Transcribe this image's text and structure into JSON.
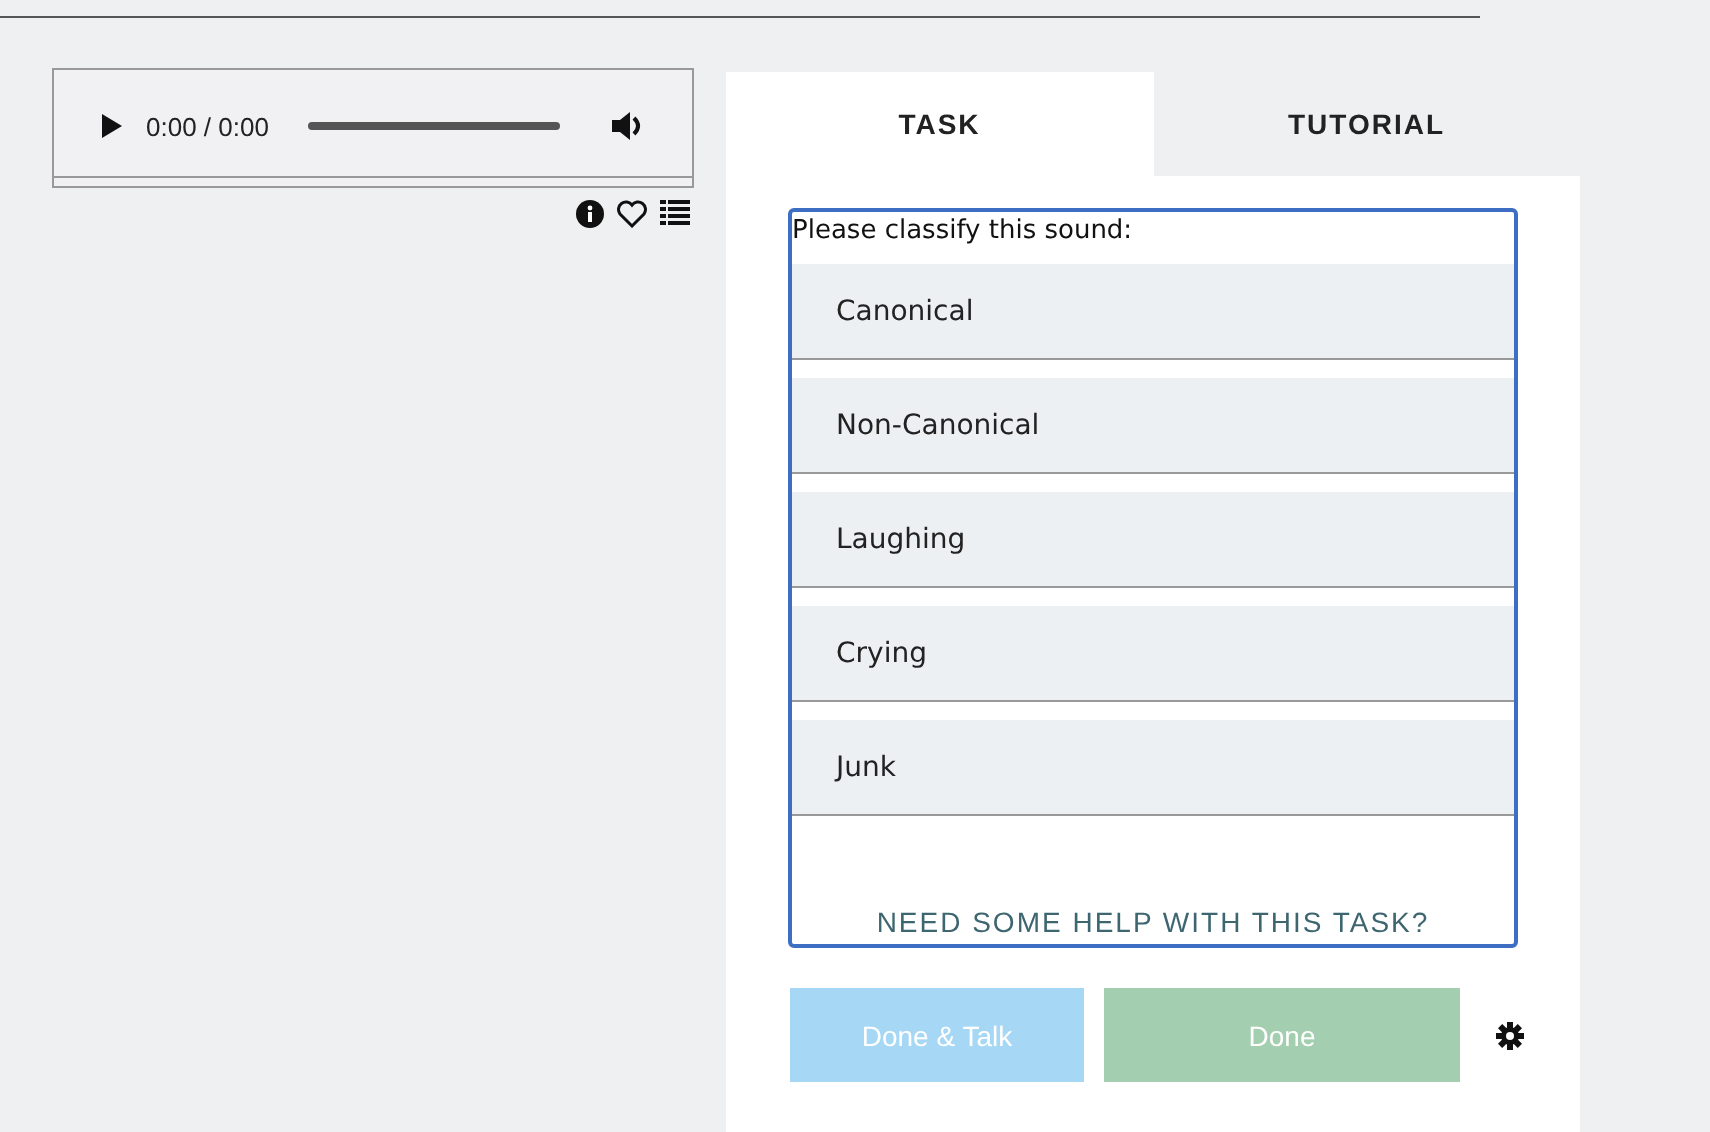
{
  "player": {
    "time": "0:00 / 0:00"
  },
  "tabs": [
    {
      "label": "TASK",
      "selected": true
    },
    {
      "label": "TUTORIAL",
      "selected": false
    }
  ],
  "question": "Please classify this sound:",
  "answers": [
    {
      "label": "Canonical"
    },
    {
      "label": "Non-Canonical"
    },
    {
      "label": "Laughing"
    },
    {
      "label": "Crying"
    },
    {
      "label": "Junk"
    }
  ],
  "help_link": "NEED SOME HELP WITH THIS TASK?",
  "buttons": [
    {
      "label": "Done & Talk",
      "kind": "talk"
    },
    {
      "label": "Done",
      "kind": "done"
    }
  ]
}
